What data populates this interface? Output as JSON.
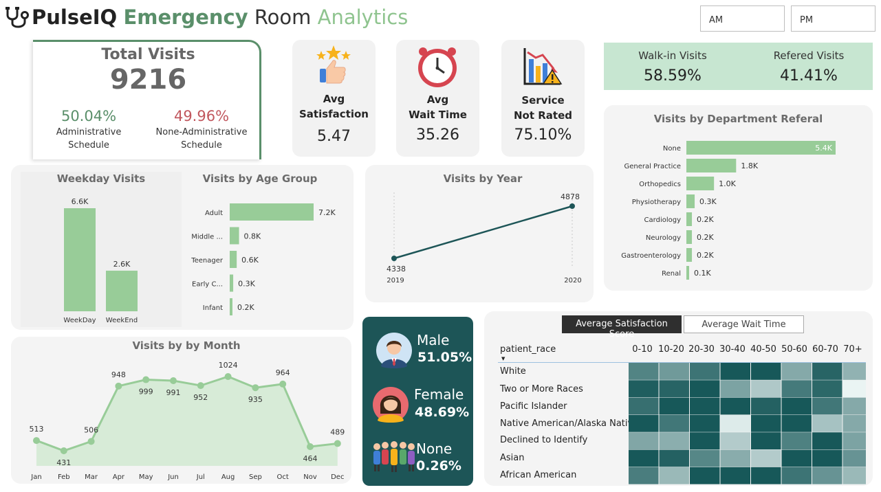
{
  "header": {
    "brand": "PulseIQ",
    "w1": "Emergency",
    "w2": "Room",
    "w3": "Analytics"
  },
  "slicers": {
    "am": "AM",
    "pm": "PM"
  },
  "total_visits": {
    "title": "Total Visits",
    "value": "9216",
    "admin_pct": "50.04%",
    "admin_label1": "Administrative",
    "admin_label2": "Schedule",
    "nonadmin_pct": "49.96%",
    "nonadmin_label1": "None-Administrative",
    "nonadmin_label2": "Schedule"
  },
  "kpis": {
    "satisfaction": {
      "l1": "Avg",
      "l2": "Satisfaction",
      "value": "5.47",
      "icon": "thumbs-up-stars-icon"
    },
    "wait": {
      "l1": "Avg",
      "l2": "Wait Time",
      "value": "35.26",
      "icon": "clock-icon"
    },
    "not_rated": {
      "l1": "Service",
      "l2": "Not Rated",
      "value": "75.10%",
      "icon": "declining-chart-warning-icon"
    }
  },
  "referral_split": {
    "walkin_label": "Walk-in Visits",
    "walkin_value": "58.59%",
    "referred_label": "Refered Visits",
    "referred_value": "41.41%"
  },
  "colors": {
    "green": "#5a8f6a",
    "light_green": "#98cc98",
    "brand_light": "#8fc48f",
    "red": "#c1575e",
    "teal": "#1d5557",
    "panel": "#f4f4f4",
    "mint": "#c7e6d1"
  },
  "gender": {
    "male_label": "Male",
    "male_value": "51.05%",
    "female_label": "Female",
    "female_value": "48.69%",
    "none_label": "None",
    "none_value": "0.26%"
  },
  "heatmap": {
    "tab_active": "Average Satisfaction Score",
    "tab_inactive": "Average Wait Time",
    "row_header": "patient_race",
    "columns": [
      "0-10",
      "10-20",
      "20-30",
      "30-40",
      "40-50",
      "50-60",
      "60-70",
      "70+"
    ],
    "rows": [
      "White",
      "Two or More Races",
      "Pacific Islander",
      "Native American/Alaska Native",
      "Declined to Identify",
      "Asian",
      "African American"
    ],
    "intensity": [
      [
        0.72,
        0.58,
        0.82,
        1.0,
        1.0,
        0.48,
        0.92,
        0.42
      ],
      [
        0.96,
        0.92,
        1.0,
        0.52,
        0.28,
        0.78,
        0.9,
        0.0
      ],
      [
        0.85,
        1.0,
        1.0,
        1.0,
        0.94,
        1.0,
        0.8,
        0.48
      ],
      [
        1.0,
        0.8,
        1.0,
        0.06,
        1.0,
        1.0,
        0.32,
        0.48
      ],
      [
        0.5,
        0.45,
        1.0,
        0.26,
        1.0,
        0.74,
        1.0,
        0.52
      ],
      [
        1.0,
        0.94,
        0.7,
        0.46,
        0.26,
        1.0,
        1.0,
        0.62
      ],
      [
        0.76,
        0.38,
        1.0,
        1.0,
        1.0,
        0.82,
        0.62,
        0.38
      ]
    ]
  },
  "chart_data": [
    {
      "type": "bar",
      "title": "Weekday Visits",
      "categories": [
        "WeekDay",
        "WeekEnd"
      ],
      "values": [
        6.6,
        2.6
      ],
      "labels": [
        "6.6K",
        "2.6K"
      ]
    },
    {
      "type": "bar",
      "orientation": "horizontal",
      "title": "Visits by Age Group",
      "categories": [
        "Adult",
        "Middle ...",
        "Teenager",
        "Early C...",
        "Infant"
      ],
      "values": [
        7.2,
        0.8,
        0.6,
        0.3,
        0.2
      ],
      "labels": [
        "7.2K",
        "0.8K",
        "0.6K",
        "0.3K",
        "0.2K"
      ]
    },
    {
      "type": "line",
      "title": "Visits by Year",
      "x": [
        "2019",
        "2020"
      ],
      "values": [
        4338,
        4878
      ]
    },
    {
      "type": "bar",
      "orientation": "horizontal",
      "title": "Visits by Department Referal",
      "categories": [
        "None",
        "General Practice",
        "Orthopedics",
        "Physiotherapy",
        "Cardiology",
        "Neurology",
        "Gastroenterology",
        "Renal"
      ],
      "values": [
        5.4,
        1.8,
        1.0,
        0.3,
        0.2,
        0.2,
        0.2,
        0.1
      ],
      "labels": [
        "5.4K",
        "1.8K",
        "1.0K",
        "0.3K",
        "0.2K",
        "0.2K",
        "0.2K",
        "0.1K"
      ]
    },
    {
      "type": "area",
      "title": "Visits by by Month",
      "x": [
        "Jan",
        "Feb",
        "Mar",
        "Apr",
        "May",
        "Jun",
        "Jul",
        "Aug",
        "Sep",
        "Oct",
        "Nov",
        "Dec"
      ],
      "values": [
        513,
        431,
        506,
        948,
        999,
        991,
        952,
        1024,
        935,
        964,
        464,
        489
      ]
    }
  ]
}
